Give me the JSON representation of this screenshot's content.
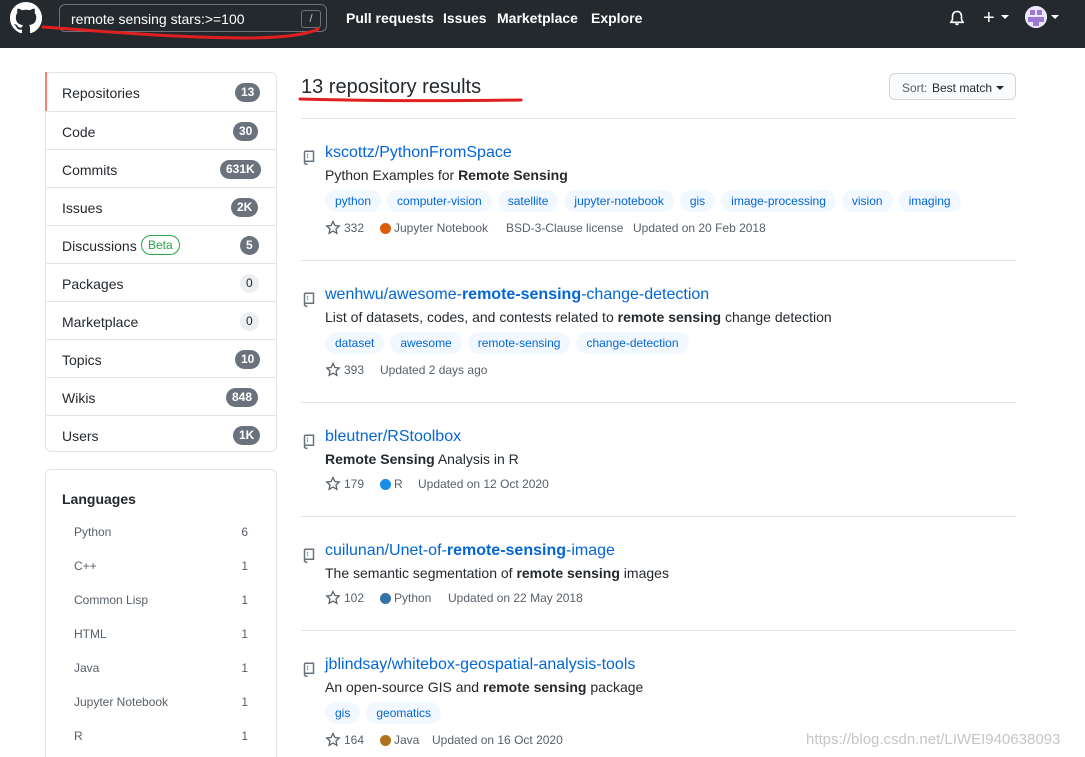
{
  "header": {
    "search": {
      "value": "remote sensing stars:>=100",
      "shortcut": "/"
    },
    "nav": [
      "Pull requests",
      "Issues",
      "Marketplace",
      "Explore"
    ],
    "plus": "+",
    "colors": {
      "background": "#24292e",
      "annotation": "#e02020"
    }
  },
  "sidebar": {
    "menu": [
      {
        "label": "Repositories",
        "count": "13",
        "selected": true
      },
      {
        "label": "Code",
        "count": "30"
      },
      {
        "label": "Commits",
        "count": "631K"
      },
      {
        "label": "Issues",
        "count": "2K"
      },
      {
        "label": "Discussions",
        "badge": "Beta",
        "count": "5"
      },
      {
        "label": "Packages",
        "count": "0"
      },
      {
        "label": "Marketplace",
        "count": "0"
      },
      {
        "label": "Topics",
        "count": "10"
      },
      {
        "label": "Wikis",
        "count": "848"
      },
      {
        "label": "Users",
        "count": "1K"
      }
    ],
    "languages": {
      "title": "Languages",
      "items": [
        {
          "name": "Python",
          "count": "6"
        },
        {
          "name": "C++",
          "count": "1"
        },
        {
          "name": "Common Lisp",
          "count": "1"
        },
        {
          "name": "HTML",
          "count": "1"
        },
        {
          "name": "Java",
          "count": "1"
        },
        {
          "name": "Jupyter Notebook",
          "count": "1"
        },
        {
          "name": "R",
          "count": "1"
        }
      ]
    }
  },
  "main": {
    "title": "13 repository results",
    "sort": {
      "label": "Sort:",
      "value": "Best match"
    },
    "repos": [
      {
        "name_parts": [
          {
            "t": "kscottz/PythonFromSpace",
            "b": false
          }
        ],
        "desc_parts": [
          {
            "t": "Python Examples for ",
            "b": false
          },
          {
            "t": "Remote Sensing",
            "b": true
          }
        ],
        "topics": [
          "python",
          "computer-vision",
          "satellite",
          "jupyter-notebook",
          "gis",
          "image-processing",
          "vision",
          "imaging"
        ],
        "stars": "332",
        "language": "Jupyter Notebook",
        "language_color": "#da5b0b",
        "license": "BSD-3-Clause license",
        "updated": "Updated on 20 Feb 2018"
      },
      {
        "name_parts": [
          {
            "t": "wenhwu/awesome-",
            "b": false
          },
          {
            "t": "remote-sensing",
            "b": true
          },
          {
            "t": "-change-detection",
            "b": false
          }
        ],
        "desc_parts": [
          {
            "t": "List of datasets, codes, and contests related to ",
            "b": false
          },
          {
            "t": "remote sensing",
            "b": true
          },
          {
            "t": " change detection",
            "b": false
          }
        ],
        "topics": [
          "dataset",
          "awesome",
          "remote-sensing",
          "change-detection"
        ],
        "stars": "393",
        "updated": "Updated 2 days ago"
      },
      {
        "name_parts": [
          {
            "t": "bleutner/RStoolbox",
            "b": false
          }
        ],
        "desc_parts": [
          {
            "t": "Remote Sensing",
            "b": true
          },
          {
            "t": " Analysis in R",
            "b": false
          }
        ],
        "topics": [],
        "stars": "179",
        "language": "R",
        "language_color": "#198ce7",
        "updated": "Updated on 12 Oct 2020"
      },
      {
        "name_parts": [
          {
            "t": "cuilunan/Unet-of-",
            "b": false
          },
          {
            "t": "remote-sensing",
            "b": true
          },
          {
            "t": "-image",
            "b": false
          }
        ],
        "desc_parts": [
          {
            "t": "The semantic segmentation of ",
            "b": false
          },
          {
            "t": "remote sensing",
            "b": true
          },
          {
            "t": " images",
            "b": false
          }
        ],
        "topics": [],
        "stars": "102",
        "language": "Python",
        "language_color": "#3572a5",
        "updated": "Updated on 22 May 2018"
      },
      {
        "name_parts": [
          {
            "t": "jblindsay/whitebox-geospatial-analysis-tools",
            "b": false
          }
        ],
        "desc_parts": [
          {
            "t": "An open-source GIS and ",
            "b": false
          },
          {
            "t": "remote sensing",
            "b": true
          },
          {
            "t": " package",
            "b": false
          }
        ],
        "topics": [
          "gis",
          "geomatics"
        ],
        "stars": "164",
        "language": "Java",
        "language_color": "#b07219",
        "updated": "Updated on 16 Oct 2020"
      }
    ]
  },
  "watermark": "https://blog.csdn.net/LIWEI940638093"
}
